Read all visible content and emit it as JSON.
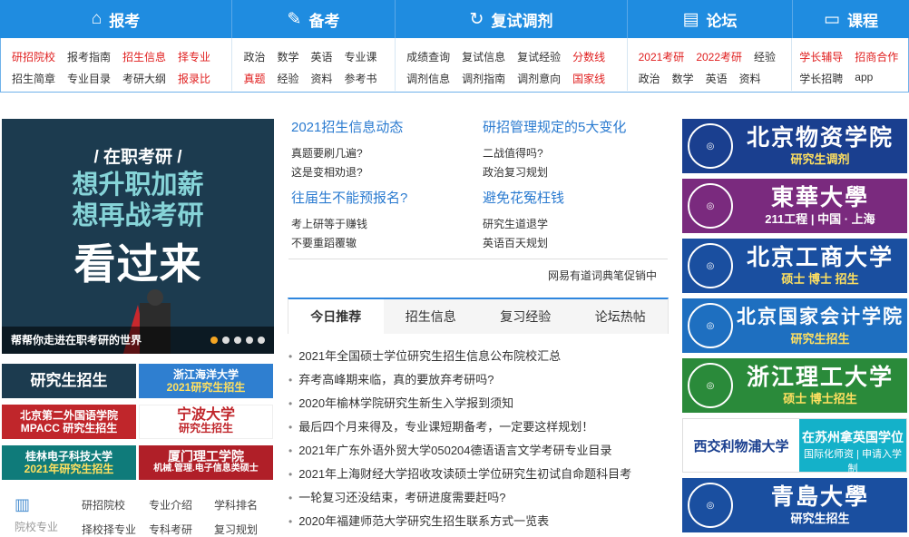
{
  "nav": {
    "tabs": [
      {
        "icon": "building-icon",
        "glyph": "⌂",
        "label": "报考"
      },
      {
        "icon": "pen-icon",
        "glyph": "✎",
        "label": "备考"
      },
      {
        "icon": "refresh-icon",
        "glyph": "↻",
        "label": "复试调剂"
      },
      {
        "icon": "chat-icon",
        "glyph": "▤",
        "label": "论坛"
      },
      {
        "icon": "screen-icon",
        "glyph": "▭",
        "label": "课程"
      }
    ]
  },
  "submenu": [
    {
      "row1": [
        "研招院校",
        "报考指南",
        "招生信息",
        "择专业"
      ],
      "row2": [
        "招生简章",
        "专业目录",
        "考研大纲",
        "报录比"
      ]
    },
    {
      "row1": [
        "政治",
        "数学",
        "英语",
        "专业课"
      ],
      "row2": [
        "真题",
        "经验",
        "资料",
        "参考书"
      ]
    },
    {
      "row1": [
        "成绩查询",
        "复试信息",
        "复试经验",
        "分数线"
      ],
      "row2": [
        "调剂信息",
        "调剂指南",
        "调剂意向",
        "国家线"
      ]
    },
    {
      "row1": [
        "2021考研",
        "2022考研",
        "经验"
      ],
      "row2": [
        "政治",
        "数学",
        "英语",
        "资料"
      ]
    },
    {
      "row1": [
        "学长辅导",
        "招商合作"
      ],
      "row2": [
        "学长招聘",
        "app"
      ]
    }
  ],
  "banner": {
    "line1": "/ 在职考研 /",
    "line2": "想升职加薪",
    "line3": "想再战考研",
    "line4": "看过来",
    "caption": "帮帮你走进在职考研的世界"
  },
  "left_ads": [
    "研究生招生",
    "浙江海洋大学",
    "2021研究生招生",
    "北京第二外国语学院",
    "MPACC 研究生招生",
    "宁波大学",
    "研究生招生",
    "桂林电子科技大学",
    "2021年研究生招生",
    "厦门理工学院",
    "机械.管理.电子信息类硕士"
  ],
  "quick_links": {
    "label": "院校专业",
    "items": [
      "研招院校",
      "专业介绍",
      "学科排名",
      "择校择专业",
      "专科考研",
      "复习规划"
    ]
  },
  "news": {
    "headline1": "2021招生信息动态",
    "headline2": "研招管理规定的5大变化",
    "items1": [
      "真题要刷几遍?",
      "这是变相劝退?"
    ],
    "items2": [
      "二战值得吗?",
      "政治复习规划"
    ],
    "headline3": "往届生不能预报名?",
    "headline4": "避免花冤枉钱",
    "items3": [
      "考上研等于赚钱",
      "不要重蹈覆辙"
    ],
    "items4": [
      "研究生道退学",
      "英语百天规划"
    ],
    "promo": "网易有道词典笔促销中"
  },
  "tabs": [
    "今日推荐",
    "招生信息",
    "复习经验",
    "论坛热帖"
  ],
  "list": [
    "2021年全国硕士学位研究生招生信息公布院校汇总",
    "弃考高峰期来临，真的要放弃考研吗?",
    "2020年榆林学院研究生新生入学报到须知",
    "最后四个月来得及，专业课短期备考，一定要这样规划！",
    "2021年广东外语外贸大学050204德语语言文学考研专业目录",
    "2021年上海财经大学招收攻读硕士学位研究生初试自命题科目考",
    "一轮复习还没结束，考研进度需要赶吗?",
    "2020年福建师范大学研究生招生联系方式一览表"
  ],
  "right_ads": [
    {
      "name": "北京物资学院",
      "sub": "研究生调剂",
      "color": "#1a3f8f"
    },
    {
      "name": "東華大學",
      "sub": "211工程 | 中国 · 上海",
      "color": "#7a2a7e"
    },
    {
      "name": "北京工商大学",
      "sub": "硕士 博士 招生",
      "color": "#1a4fa0"
    },
    {
      "name": "北京国家会计学院",
      "sub": "研究生招生",
      "color": "#1e6fc0"
    },
    {
      "name": "浙江理工大学",
      "sub": "硕士 博士招生",
      "color": "#2a8a3a"
    },
    {
      "name": "西交利物浦大学",
      "sub": "在苏州拿英国学位",
      "sub2": "国际化师资 | 申请入学制",
      "color": "#ffffff"
    },
    {
      "name": "青島大學",
      "sub": "研究生招生",
      "color": "#1a4fa0"
    }
  ],
  "colors": {
    "nav": "#1f8ce0",
    "link_red": "#e02020",
    "headline": "#2b7bd0"
  }
}
